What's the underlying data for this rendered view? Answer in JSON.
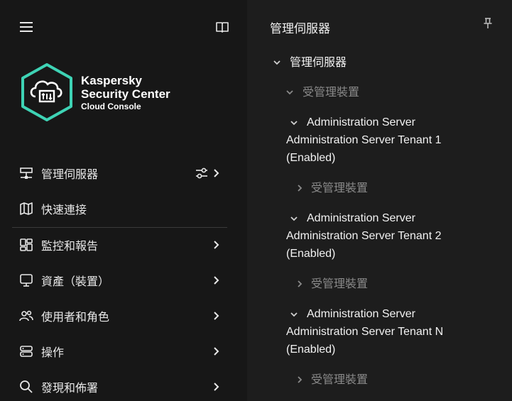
{
  "sidebar": {
    "logo": {
      "line1": "Kaspersky",
      "line2": "Security Center",
      "line3": "Cloud Console",
      "accent_color": "#3ed3b5"
    },
    "items": [
      {
        "label": "管理伺服器",
        "icon": "server-icon",
        "has_settings": true,
        "has_chevron": true
      },
      {
        "label": "快速連接",
        "icon": "map-icon",
        "has_settings": false,
        "has_chevron": false
      },
      {
        "label": "監控和報告",
        "icon": "dashboard-icon",
        "has_settings": false,
        "has_chevron": true
      },
      {
        "label": "資產（裝置）",
        "icon": "monitor-icon",
        "has_settings": false,
        "has_chevron": true
      },
      {
        "label": "使用者和角色",
        "icon": "users-icon",
        "has_settings": false,
        "has_chevron": true
      },
      {
        "label": "操作",
        "icon": "operations-icon",
        "has_settings": false,
        "has_chevron": true
      },
      {
        "label": "發現和佈署",
        "icon": "search-icon",
        "has_settings": false,
        "has_chevron": true
      }
    ]
  },
  "panel": {
    "title": "管理伺服器",
    "tree": {
      "root": "管理伺服器",
      "root_child": "受管理裝置",
      "tenants": [
        {
          "line1": "Administration Server",
          "line2": "Administration Server Tenant 1",
          "line3": "(Enabled)",
          "child": "受管理裝置"
        },
        {
          "line1": "Administration Server",
          "line2": "Administration Server Tenant 2",
          "line3": "(Enabled)",
          "child": "受管理裝置"
        },
        {
          "line1": "Administration Server",
          "line2": "Administration Server Tenant N",
          "line3": "(Enabled)",
          "child": "受管理裝置"
        }
      ]
    }
  }
}
